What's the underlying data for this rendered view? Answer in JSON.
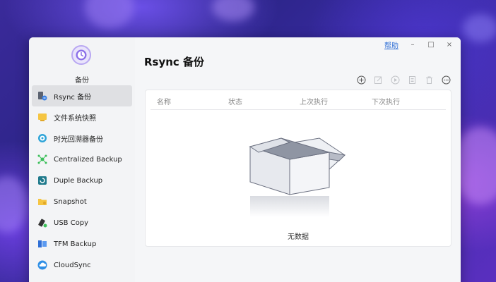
{
  "app": {
    "title": "备份"
  },
  "window": {
    "help": "帮助",
    "minimize": "–",
    "maximize": "□",
    "close": "×"
  },
  "sidebar": {
    "items": [
      {
        "label": "Rsync 备份",
        "icon": "rsync-icon",
        "active": true
      },
      {
        "label": "文件系统快照",
        "icon": "snapshot-folder-icon"
      },
      {
        "label": "时光回溯器备份",
        "icon": "time-machine-icon"
      },
      {
        "label": "Centralized Backup",
        "icon": "centralized-backup-icon"
      },
      {
        "label": "Duple Backup",
        "icon": "duple-backup-icon"
      },
      {
        "label": "Snapshot",
        "icon": "snapshot-icon"
      },
      {
        "label": "USB Copy",
        "icon": "usb-copy-icon"
      },
      {
        "label": "TFM Backup",
        "icon": "tfm-backup-icon"
      },
      {
        "label": "CloudSync",
        "icon": "cloudsync-icon"
      }
    ]
  },
  "main": {
    "title": "Rsync 备份",
    "toolbar": [
      "add-icon",
      "edit-icon",
      "play-icon",
      "log-icon",
      "delete-icon",
      "more-icon"
    ],
    "table": {
      "columns": [
        "名称",
        "状态",
        "上次执行",
        "下次执行"
      ],
      "rows": []
    },
    "empty_text": "无数据"
  },
  "colors": {
    "accent": "#2f6fd6",
    "active_bg": "#dfe0e3",
    "brand": "#8b6fe8"
  }
}
